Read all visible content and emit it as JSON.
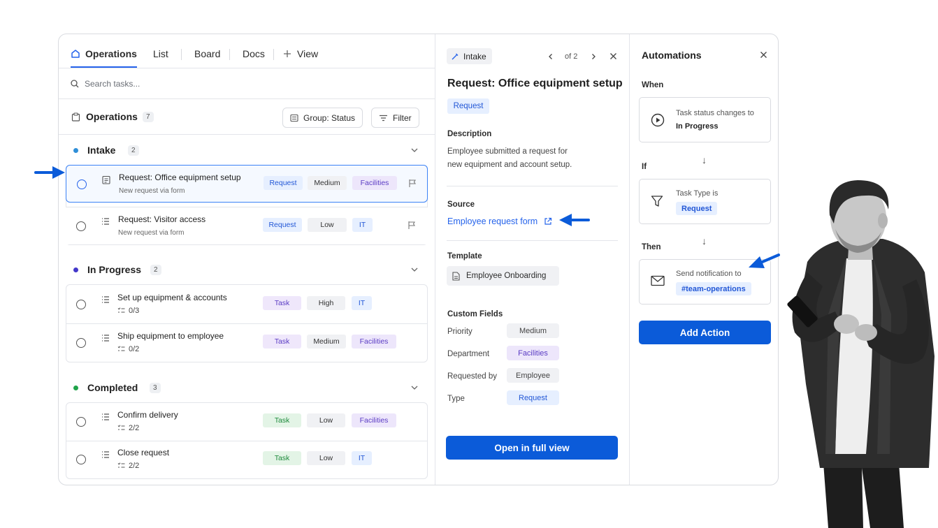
{
  "tabs": [
    {
      "label": "Operations",
      "icon": "home-icon",
      "active": true
    },
    {
      "label": "List"
    },
    {
      "label": "Board"
    },
    {
      "label": "Docs"
    },
    {
      "label": "View",
      "icon": "plus-icon"
    }
  ],
  "search": {
    "placeholder": "Search tasks..."
  },
  "ops_header": {
    "title": "Operations",
    "count": "7",
    "group_label": "Group: Status",
    "filter_label": "Filter"
  },
  "groups": [
    {
      "title": "Intake",
      "count": "2",
      "color": "#2f8fd8",
      "tasks": [
        {
          "title": "Request: Office equipment setup",
          "sub": "New request via form",
          "type": "Request",
          "priority": "Medium",
          "dept": "Facilities",
          "selected": true
        },
        {
          "title": "Request: Visitor access",
          "sub": "New request via form",
          "type": "Request",
          "priority": "Low",
          "dept": "IT"
        }
      ]
    },
    {
      "title": "In Progress",
      "count": "2",
      "color": "#4338ca",
      "tasks": [
        {
          "title": "Set up equipment & accounts",
          "sub": "0/3",
          "type": "Task",
          "priority": "High",
          "dept": "IT"
        },
        {
          "title": "Ship equipment to employee",
          "sub": "0/2",
          "type": "Task",
          "priority": "Medium",
          "dept": "Facilities"
        }
      ]
    },
    {
      "title": "Completed",
      "count": "3",
      "color": "#1fa34a",
      "tasks": [
        {
          "title": "Confirm delivery",
          "sub": "2/2",
          "type": "Task",
          "priority": "Low",
          "dept": "Facilities"
        },
        {
          "title": "Close request",
          "sub": "2/2",
          "type": "Task",
          "priority": "Low",
          "dept": "IT"
        }
      ]
    }
  ],
  "detail": {
    "chip": "Intake",
    "pager": "of 2",
    "title": "Request: Office equipment setup",
    "type_badge": "Request",
    "description_label": "Description",
    "description": "Employee submitted a request for new equipment and account setup.",
    "source_label": "Source",
    "source_link": "Employee request form",
    "template_label": "Template",
    "template": "Employee Onboarding",
    "custom_fields_label": "Custom Fields",
    "fields": [
      {
        "key": "Priority",
        "value": "Medium"
      },
      {
        "key": "Department",
        "value": "Facilities"
      },
      {
        "key": "Requested by",
        "value": "Employee"
      },
      {
        "key": "Type",
        "value": "Request"
      }
    ],
    "open_button": "Open in full view"
  },
  "automations": {
    "title": "Automations",
    "when_label": "When",
    "when_text": "Task status changes to",
    "when_value": "In Progress",
    "if_label": "If",
    "if_text": "Task Type is",
    "if_value": "Request",
    "then_label": "Then",
    "then_text": "Send notification to",
    "then_value": "#team-operations",
    "add_button": "Add Action"
  },
  "arrow_glyph": "↓",
  "colors": {
    "accent": "#2563eb",
    "primary_button": "#0b5bd9",
    "tag_request_bg": "#e6efff",
    "tag_task_bg": "#efe7fb",
    "tag_task_done_bg": "#e3f4e6",
    "tag_neutral_bg": "#f0f1f4",
    "tag_facilities_bg": "#ede6fb",
    "tag_it_bg": "#e6efff"
  }
}
